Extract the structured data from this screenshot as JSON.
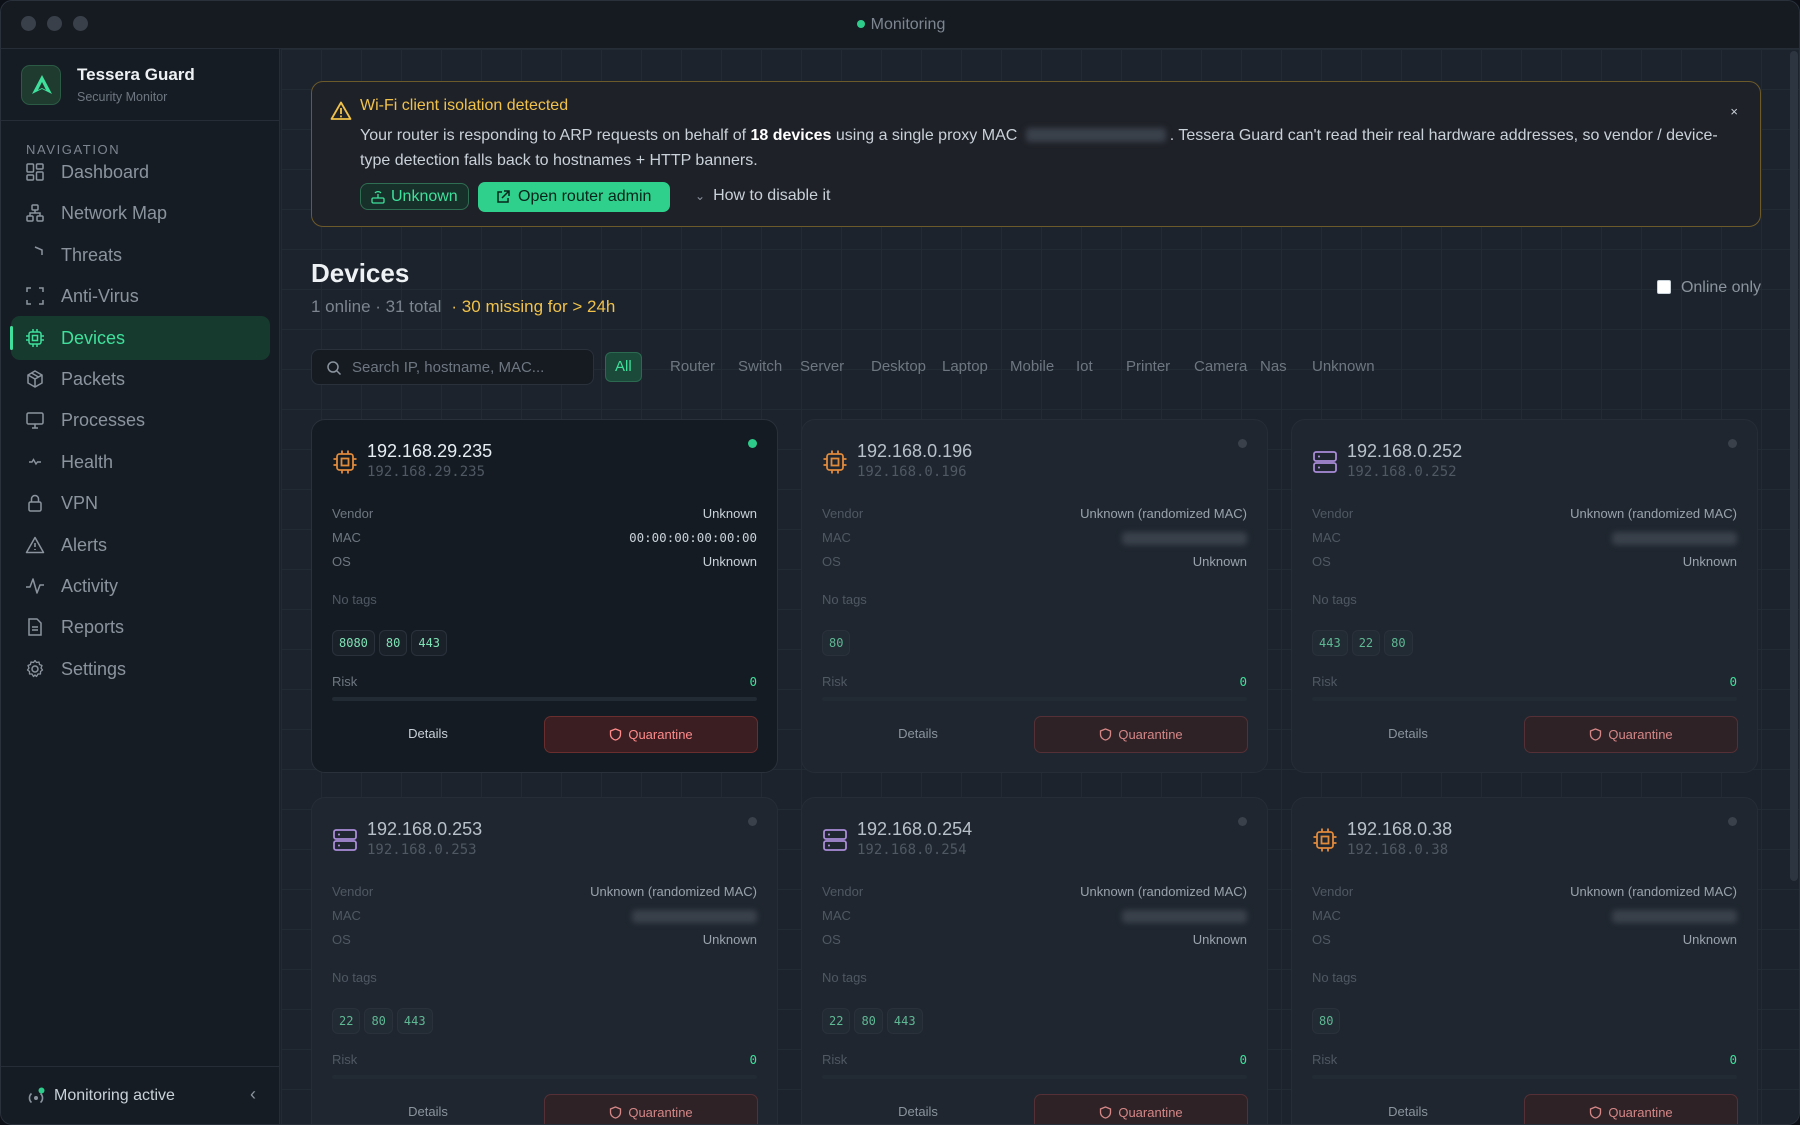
{
  "window": {
    "title": "Monitoring"
  },
  "brand": {
    "name": "Tessera Guard",
    "subtitle": "Security Monitor"
  },
  "nav": {
    "heading": "NAVIGATION",
    "items": [
      {
        "label": "Dashboard",
        "icon": "dashboard-icon"
      },
      {
        "label": "Network Map",
        "icon": "network-map-icon"
      },
      {
        "label": "Threats",
        "icon": "shield-icon"
      },
      {
        "label": "Anti-Virus",
        "icon": "scan-icon"
      },
      {
        "label": "Devices",
        "icon": "chip-icon",
        "active": true
      },
      {
        "label": "Packets",
        "icon": "package-icon"
      },
      {
        "label": "Processes",
        "icon": "monitor-icon"
      },
      {
        "label": "Health",
        "icon": "heart-pulse-icon"
      },
      {
        "label": "VPN",
        "icon": "lock-icon"
      },
      {
        "label": "Alerts",
        "icon": "warning-icon"
      },
      {
        "label": "Activity",
        "icon": "activity-icon"
      },
      {
        "label": "Reports",
        "icon": "file-icon"
      },
      {
        "label": "Settings",
        "icon": "gear-icon"
      }
    ]
  },
  "footer": {
    "status": "Monitoring active"
  },
  "alert": {
    "title": "Wi-Fi client isolation detected",
    "body_before": "Your router is responding to ARP requests on behalf of ",
    "body_bold": "18 devices",
    "body_middle": " using a single proxy MAC ",
    "body_after": ". Tessera Guard can't read their real hardware addresses, so vendor / device-type detection falls back to hostnames + HTTP banners.",
    "close": "×",
    "chip": "Unknown",
    "router_button": "Open router admin",
    "howto": "How to disable it"
  },
  "devices": {
    "title": "Devices",
    "summary": "1 online · 31 total",
    "missing": "· 30 missing for > 24h",
    "online_only": "Online only",
    "search_placeholder": "Search IP, hostname, MAC...",
    "filters": [
      "All",
      "Router",
      "Switch",
      "Server",
      "Desktop",
      "Laptop",
      "Mobile",
      "Iot",
      "Printer",
      "Camera",
      "Nas",
      "Unknown"
    ],
    "labels": {
      "vendor": "Vendor",
      "mac": "MAC",
      "os": "OS",
      "no_tags": "No tags",
      "risk": "Risk",
      "details": "Details",
      "quarantine": "Quarantine"
    },
    "cards": [
      {
        "ip": "192.168.29.235",
        "ip2": "192.168.29.235",
        "icon": "chip",
        "online": true,
        "vendor": "Unknown",
        "mac": "00:00:00:00:00:00",
        "os": "Unknown",
        "ports": [
          "8080",
          "80",
          "443"
        ],
        "risk": "0",
        "risk_level": 0
      },
      {
        "ip": "192.168.0.196",
        "ip2": "192.168.0.196",
        "icon": "chip",
        "online": false,
        "vendor": "Unknown (randomized MAC)",
        "mac": "",
        "os": "Unknown",
        "ports": [
          "80"
        ],
        "risk": "0",
        "risk_level": 0
      },
      {
        "ip": "192.168.0.252",
        "ip2": "192.168.0.252",
        "icon": "server",
        "online": false,
        "vendor": "Unknown (randomized MAC)",
        "mac": "",
        "os": "Unknown",
        "ports": [
          "443",
          "22",
          "80"
        ],
        "risk": "0",
        "risk_level": 0
      },
      {
        "ip": "192.168.0.253",
        "ip2": "192.168.0.253",
        "icon": "server",
        "online": false,
        "vendor": "Unknown (randomized MAC)",
        "mac": "",
        "os": "Unknown",
        "ports": [
          "22",
          "80",
          "443"
        ],
        "risk": "0",
        "risk_level": 0
      },
      {
        "ip": "192.168.0.254",
        "ip2": "192.168.0.254",
        "icon": "server",
        "online": false,
        "vendor": "Unknown (randomized MAC)",
        "mac": "",
        "os": "Unknown",
        "ports": [
          "22",
          "80",
          "443"
        ],
        "risk": "0",
        "risk_level": 0
      },
      {
        "ip": "192.168.0.38",
        "ip2": "192.168.0.38",
        "icon": "chip",
        "online": false,
        "vendor": "Unknown (randomized MAC)",
        "mac": "",
        "os": "Unknown",
        "ports": [
          "80"
        ],
        "risk": "0",
        "risk_level": 0
      }
    ]
  },
  "colors": {
    "accent": "#3ee09b",
    "warning": "#f0c24b",
    "danger": "#ff8b8b",
    "chip_icon": "#e08a3c",
    "server_icon": "#a98bd8"
  }
}
